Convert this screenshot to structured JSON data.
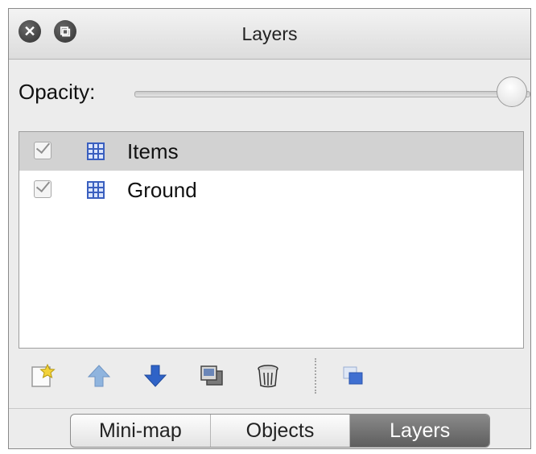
{
  "window": {
    "title": "Layers",
    "close_glyph": "✕",
    "restore_glyph": "⧉"
  },
  "opacity": {
    "label": "Opacity:",
    "value_fraction": 1.0
  },
  "layers": [
    {
      "name": "Items",
      "visible": true,
      "selected": true,
      "icon": "tile-layer-icon"
    },
    {
      "name": "Ground",
      "visible": true,
      "selected": false,
      "icon": "tile-layer-icon"
    }
  ],
  "toolbar": {
    "icons": [
      "new-layer-icon",
      "move-layer-up-icon",
      "move-layer-down-icon",
      "duplicate-layer-icon",
      "delete-layer-icon",
      "layer-options-icon"
    ]
  },
  "tabs": {
    "items": [
      "Mini-map",
      "Objects",
      "Layers"
    ],
    "active": "Layers"
  },
  "colors": {
    "arrow_up": "#8fb4de",
    "arrow_down": "#2f63c7",
    "grid_icon": "#3a5fbf",
    "selected_row": "#d2d2d2",
    "active_tab": "#6e6e6e"
  }
}
